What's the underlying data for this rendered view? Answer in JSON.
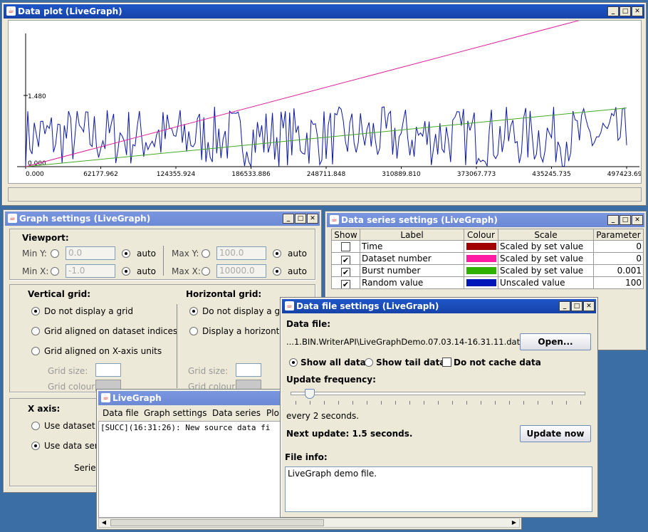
{
  "plot_window": {
    "title": "Data plot (LiveGraph)",
    "y_tick_label": "1.480",
    "y_zero_label": "0.000",
    "x_tick_labels": [
      "0.000",
      "62177.962",
      "124355.924",
      "186533.886",
      "248711.848",
      "310889.810",
      "373067.773",
      "435245.735",
      "497423.697"
    ]
  },
  "chart_data": {
    "type": "line",
    "x_ticks": [
      0.0,
      62177.962,
      124355.924,
      186533.886,
      248711.848,
      310889.81,
      373067.773,
      435245.735,
      497423.697
    ],
    "y_ticks": [
      0.0,
      1.48
    ],
    "series": [
      {
        "color": "#e0209c",
        "start": [
          0,
          0.0
        ],
        "end": [
          497423.697,
          3.3
        ]
      },
      {
        "color": "#44aa22",
        "start": [
          0,
          0.0
        ],
        "end": [
          497423.697,
          1.22
        ]
      },
      {
        "color": "#0a16a6",
        "random": true,
        "range": [
          0.0,
          1.25
        ]
      }
    ],
    "grid": false
  },
  "graph_settings": {
    "title": "Graph settings (LiveGraph)",
    "viewport_label": "Viewport:",
    "min_y_label": "Min Y:",
    "min_y_value": "0.0",
    "min_x_label": "Min X:",
    "min_x_value": "-1.0",
    "max_y_label": "Max Y:",
    "max_y_value": "100.0",
    "max_x_label": "Max X:",
    "max_x_value": "10000.0",
    "auto_label": "auto",
    "vertical_grid_label": "Vertical grid:",
    "vgrid_options": [
      "Do not display a grid",
      "Grid aligned on dataset indices",
      "Grid aligned on X-axis units"
    ],
    "horizontal_grid_label": "Horizontal grid:",
    "hgrid_options": [
      "Do not display a grid",
      "Display a horizontal grid"
    ],
    "grid_size_label": "Grid size:",
    "grid_colour_label": "Grid colour:",
    "x_axis_label": "X axis:",
    "x_axis_options": [
      "Use dataset n",
      "Use data seri"
    ],
    "series_label": "Series:"
  },
  "data_series": {
    "title": "Data series settings (LiveGraph)",
    "headers": [
      "Show",
      "Label",
      "Colour",
      "Scale",
      "Parameter"
    ],
    "rows": [
      {
        "show": false,
        "label": "Time",
        "color": "#a00000",
        "scale": "Scaled by set value",
        "param": "0"
      },
      {
        "show": true,
        "label": "Dataset number",
        "color": "#ff1aa3",
        "scale": "Scaled by set value",
        "param": "0"
      },
      {
        "show": true,
        "label": "Burst number",
        "color": "#2fb100",
        "scale": "Scaled by set value",
        "param": "0.001"
      },
      {
        "show": true,
        "label": "Random value",
        "color": "#0016b8",
        "scale": "Unscaled value",
        "param": "100"
      }
    ]
  },
  "livegraph": {
    "title": "LiveGraph",
    "menu": [
      "Data file",
      "Graph settings",
      "Data series",
      "Plo"
    ],
    "log": "[SUCC](16:31:26): New source data fi"
  },
  "data_file": {
    "title": "Data file settings (LiveGraph)",
    "data_file_label": "Data file:",
    "path": "...1.BIN.WriterAPI\\LiveGraphDemo.07.03.14-16.31.11.dat",
    "open_button": "Open...",
    "show_all": "Show all data",
    "show_tail": "Show tail data",
    "no_cache": "Do not cache data",
    "update_freq_label": "Update frequency:",
    "slider_fraction": 0.05,
    "every_text": "every 2 seconds.",
    "next_update": "Next update: 1.5 seconds.",
    "update_now_button": "Update now",
    "file_info_label": "File info:",
    "file_info": "LiveGraph demo file."
  }
}
